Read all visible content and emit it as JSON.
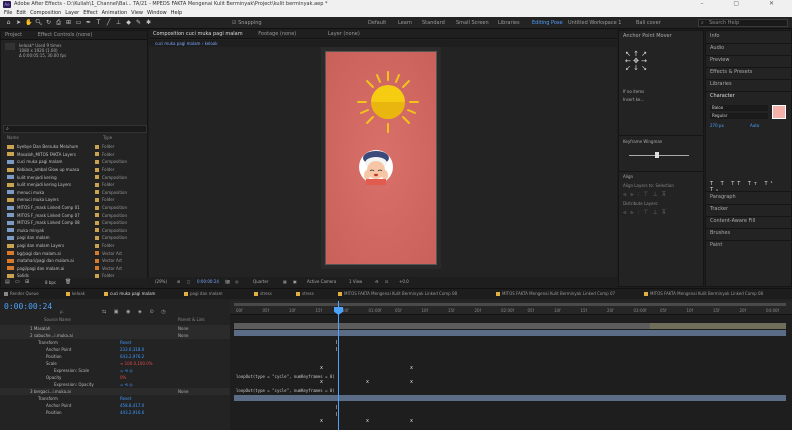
{
  "titlebar": {
    "logo": "Ae",
    "title": "Adobe After Effects - D:\\Kuliah\\1_Channel\\Bai... TA/21 - MPEDS FAKTA Mengenai Kulit Berminyak\\Project\\kulit berminyak.aep *",
    "window_controls": "–  ▢  ✕"
  },
  "menubar": [
    "File",
    "Edit",
    "Composition",
    "Layer",
    "Effect",
    "Animation",
    "View",
    "Window",
    "Help"
  ],
  "toolbar": {
    "snapping_label": "Snapping",
    "workspaces": [
      {
        "label": "Default",
        "active": false
      },
      {
        "label": "Learn",
        "active": false
      },
      {
        "label": "Standard",
        "active": false
      },
      {
        "label": "Small Screen",
        "active": false
      },
      {
        "label": "Libraries",
        "active": false
      },
      {
        "label": "Editing Pose",
        "active": true
      },
      {
        "label": "Untitled Workspace 1",
        "active": false
      },
      {
        "label": "Bali cover",
        "active": false
      }
    ],
    "search_placeholder": "Search Help"
  },
  "project": {
    "tab_label": "Project",
    "tab2_label": "Effect Controls (none)",
    "info_lines": [
      "keloak* Used 9 times",
      "1080 x 1920 (1.00)",
      "Δ 0:00:05:15, 30.00 fps"
    ],
    "search_value": "",
    "col_name": "Name",
    "col_type": "Type",
    "items": [
      {
        "name": "byebye Dan Bersuka Meluhum",
        "type": "Folder",
        "icon": "folder",
        "color": "#c9a34e",
        "selected": false
      },
      {
        "name": "Masalah_MITOS FAKTA Layers",
        "type": "Folder",
        "icon": "folder",
        "color": "#c9a34e",
        "selected": false
      },
      {
        "name": "cuci muka pagi malam",
        "type": "Composition",
        "icon": "comp",
        "color": "#c9a34e",
        "selected": false
      },
      {
        "name": "Kebiasa_ambal Glow up muasa",
        "type": "Folder",
        "icon": "folder",
        "color": "#c9a34e",
        "selected": false
      },
      {
        "name": "kulit menjadi kering",
        "type": "Composition",
        "icon": "comp",
        "color": "#c9a34e",
        "selected": false
      },
      {
        "name": "kulit menjadi kering Layers",
        "type": "Folder",
        "icon": "folder",
        "color": "#c9a34e",
        "selected": false
      },
      {
        "name": "menuci muka",
        "type": "Composition",
        "icon": "comp",
        "color": "#c9a34e",
        "selected": false
      },
      {
        "name": "menuci muka Layers",
        "type": "Folder",
        "icon": "folder",
        "color": "#c9a34e",
        "selected": false
      },
      {
        "name": "MITOS F_mask Linked Comp 01",
        "type": "Composition",
        "icon": "comp",
        "color": "#c9a34e",
        "selected": false
      },
      {
        "name": "MITOS F_mask Linked Comp 07",
        "type": "Composition",
        "icon": "comp",
        "color": "#c9a34e",
        "selected": false
      },
      {
        "name": "MITOS F_mask Linked Comp 08",
        "type": "Composition",
        "icon": "comp",
        "color": "#c9a34e",
        "selected": false
      },
      {
        "name": "muka minyak",
        "type": "Composition",
        "icon": "comp",
        "color": "#c9a34e",
        "selected": false
      },
      {
        "name": "pagi dan malam",
        "type": "Composition",
        "icon": "comp",
        "color": "#c9a34e",
        "selected": false
      },
      {
        "name": "pagi dan malam Layers",
        "type": "Folder",
        "icon": "folder",
        "color": "#c9a34e",
        "selected": false
      },
      {
        "name": "bg/pagi dan malam.ai",
        "type": "Vector Art",
        "icon": "vec",
        "color": "#d57b2b",
        "selected": false
      },
      {
        "name": "matahari/pagi dan malam.ai",
        "type": "Vector Art",
        "icon": "vec",
        "color": "#d57b2b",
        "selected": false
      },
      {
        "name": "pagi/pagi dan malam.ai",
        "type": "Vector Art",
        "icon": "vec",
        "color": "#d57b2b",
        "selected": false
      },
      {
        "name": "Solids",
        "type": "Folder",
        "icon": "folder",
        "color": "#c9a34e",
        "selected": false
      },
      {
        "name": "stress",
        "type": "Composition",
        "icon": "comp",
        "color": "#c9a34e",
        "selected": false
      },
      {
        "name": "stress",
        "type": "Composition",
        "icon": "comp",
        "color": "#c9a34e",
        "selected": false
      },
      {
        "name": "stress Layers",
        "type": "Folder",
        "icon": "folder",
        "color": "#c9a34e",
        "selected": false
      },
      {
        "name": "keloak",
        "type": "Composition",
        "icon": "comp",
        "color": "#c9a34e",
        "selected": true
      }
    ],
    "bpc": "8 bpc"
  },
  "viewer": {
    "comp_tab": "Composition cuci muka pagi malam",
    "footage_tab": "Footage (none)",
    "layer_tab": "Layer (none)",
    "breadcrumb": "cuci muka pagi malam  ›  keloak",
    "zoom": "(29%)",
    "timecode": "0:00:00:24",
    "quality": "Quarter",
    "camera": "Active Camera",
    "views": "1 View",
    "exposure": "+0.0"
  },
  "right1": {
    "anchor_title": "Anchor Point Mover",
    "if_nothing": "If no items",
    "insert_label": "Insert ke...",
    "keyframe_title": "Keyframe Wingman",
    "align_title": "Align",
    "align_to": "Align Layers to:",
    "align_to_val": "Selection",
    "distribute": "Distribute Layers:"
  },
  "right2": {
    "items": [
      "Info",
      "Audio",
      "Preview",
      "Effects & Presets",
      "Libraries",
      "Character"
    ],
    "font": "Baloo",
    "style": "Regular",
    "size": "270 px",
    "leading": "Auto",
    "paragraph": "Paragraph",
    "tracker": "Tracker",
    "content_fill": "Content-Aware Fill",
    "brushes": "Brushes",
    "paint": "Paint"
  },
  "timeline": {
    "tabs": [
      {
        "label": "Render Queue",
        "color": "#888888",
        "active": false
      },
      {
        "label": "keloak",
        "color": "#e0b042",
        "active": false
      },
      {
        "label": "cuci muka pagi malam",
        "color": "#e0b042",
        "active": true
      },
      {
        "label": "pagi dan malam",
        "color": "#e0b042",
        "active": false
      },
      {
        "label": "stress",
        "color": "#e0b042",
        "active": false
      },
      {
        "label": "stress",
        "color": "#e0b042",
        "active": false
      },
      {
        "label": "MITOS FAKTA Mengenai Kulit Berminyak Linked Comp 08",
        "color": "#e0b042",
        "active": false
      },
      {
        "label": "MITOS FAKTA Mengenai Kulit Berminyak Linked Comp 07",
        "color": "#e0b042",
        "active": false
      },
      {
        "label": "MITOS FAKTA Mengenai Kulit Berminyak Linked Comp 08",
        "color": "#e0b042",
        "active": false
      }
    ],
    "timecode": "0:00:00:24",
    "col_source": "Source Name",
    "col_parent": "Parent & Link",
    "ruler_labels": [
      "00f",
      "05f",
      "10f",
      "15f",
      "20f",
      "01:00f",
      "05f",
      "10f",
      "15f",
      "20f",
      "02:00f",
      "05f",
      "10f",
      "15f",
      "20f",
      "03:00f",
      "05f",
      "10f",
      "15f",
      "20f",
      "04:00f"
    ],
    "rows": [
      {
        "label": "1   Masalah",
        "val": "",
        "mode": "None",
        "indent": 0
      },
      {
        "label": "2   sabuche...i.muka.ai",
        "val": "",
        "mode": "None",
        "indent": 0
      },
      {
        "label": "Transform",
        "val": "Reset",
        "mode": "",
        "indent": 1
      },
      {
        "label": "Anchor Point",
        "val": "233.0,318.0",
        "mode": "",
        "indent": 2
      },
      {
        "label": "Position",
        "val": "643.2,976.2",
        "mode": "",
        "indent": 2
      },
      {
        "label": "Scale",
        "val": "∞ 100.0,100.0%",
        "mode": "",
        "indent": 2,
        "red": true
      },
      {
        "label": "Expression: Scale",
        "val": "= ⟲ ◎",
        "mode": "",
        "indent": 3
      },
      {
        "label": "Opacity",
        "val": "0%",
        "mode": "",
        "indent": 2,
        "red": true
      },
      {
        "label": "Expression: Opacity",
        "val": "= ⟲ ◎",
        "mode": "",
        "indent": 3
      },
      {
        "label": "3   bergaci...i.muka.ai",
        "val": "",
        "mode": "None",
        "indent": 0
      },
      {
        "label": "Transform",
        "val": "Reset",
        "mode": "",
        "indent": 1
      },
      {
        "label": "Anchor Point",
        "val": "458.8,417.0",
        "mode": "",
        "indent": 2
      },
      {
        "label": "Position",
        "val": "443.2,916.6",
        "mode": "",
        "indent": 2
      }
    ],
    "expressions": [
      "loopOut(type = \"cycle\", numKeyframes = 0)",
      "loopOut(type = \"cycle\", numKeyframes = 0)"
    ]
  }
}
